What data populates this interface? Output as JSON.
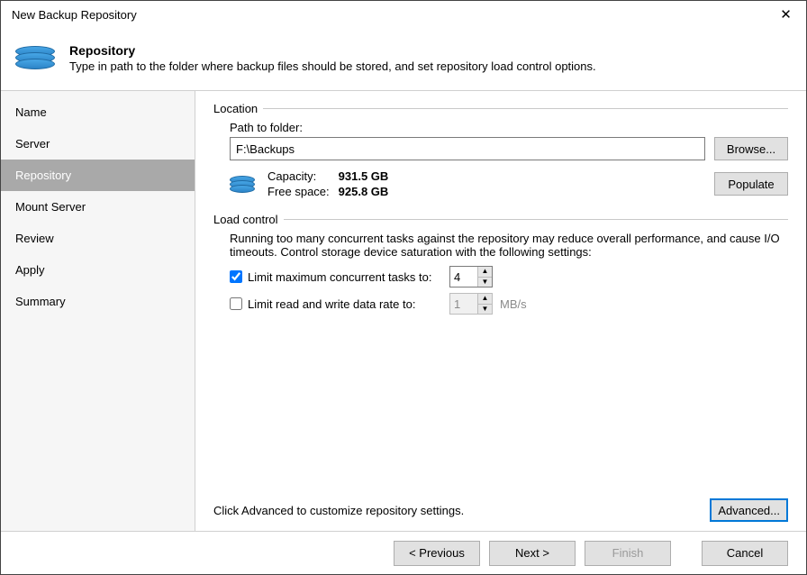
{
  "window": {
    "title": "New Backup Repository",
    "close_glyph": "✕"
  },
  "banner": {
    "title": "Repository",
    "subtitle": "Type in path to the folder where backup files should be stored, and set repository load control options."
  },
  "sidebar": {
    "items": [
      {
        "label": "Name"
      },
      {
        "label": "Server"
      },
      {
        "label": "Repository"
      },
      {
        "label": "Mount Server"
      },
      {
        "label": "Review"
      },
      {
        "label": "Apply"
      },
      {
        "label": "Summary"
      }
    ],
    "active_index": 2
  },
  "location": {
    "group": "Location",
    "path_label": "Path to folder:",
    "path_value": "F:\\Backups",
    "browse": "Browse...",
    "populate": "Populate",
    "capacity_label": "Capacity:",
    "capacity_value": "931.5 GB",
    "free_label": "Free space:",
    "free_value": "925.8 GB"
  },
  "load_control": {
    "group": "Load control",
    "desc": "Running too many concurrent tasks against the repository may reduce overall performance, and cause I/O timeouts. Control storage device saturation with the following settings:",
    "limit_tasks_label": "Limit maximum concurrent tasks to:",
    "limit_tasks_checked": true,
    "limit_tasks_value": "4",
    "limit_rate_label": "Limit read and write data rate to:",
    "limit_rate_checked": false,
    "limit_rate_value": "1",
    "limit_rate_unit": "MB/s"
  },
  "advanced": {
    "hint": "Click Advanced to customize repository settings.",
    "button": "Advanced..."
  },
  "footer": {
    "previous": "< Previous",
    "next": "Next >",
    "finish": "Finish",
    "cancel": "Cancel"
  }
}
